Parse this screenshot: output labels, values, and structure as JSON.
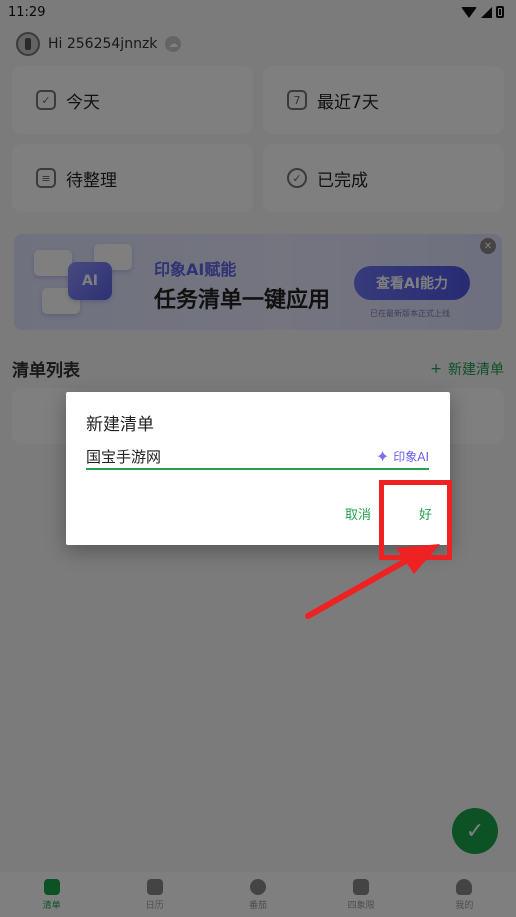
{
  "status_bar": {
    "time": "11:29"
  },
  "profile": {
    "greeting": "Hi 256254jnnzk"
  },
  "smart_lists": [
    {
      "label": "今天",
      "icon": "calendar-today-icon"
    },
    {
      "label": "最近7天",
      "icon": "calendar-week-icon"
    },
    {
      "label": "待整理",
      "icon": "inbox-icon"
    },
    {
      "label": "已完成",
      "icon": "check-circle-icon"
    }
  ],
  "banner": {
    "badge": "AI",
    "subtitle": "印象AI赋能",
    "title": "任务清单一键应用",
    "cta": "查看AI能力",
    "note": "已在最新版本正式上线"
  },
  "list_section": {
    "title": "清单列表",
    "new_button": "新建清单"
  },
  "bottom_nav": [
    {
      "label": "清单",
      "active": true
    },
    {
      "label": "日历",
      "active": false
    },
    {
      "label": "番茄",
      "active": false
    },
    {
      "label": "四象限",
      "active": false
    },
    {
      "label": "我的",
      "active": false
    }
  ],
  "dialog": {
    "title": "新建清单",
    "input_value": "国宝手游网",
    "ai_label": "印象AI",
    "cancel": "取消",
    "ok": "好"
  },
  "colors": {
    "accent": "#22a24f",
    "ai_purple": "#6066e6",
    "annotation_red": "#ee2222"
  }
}
